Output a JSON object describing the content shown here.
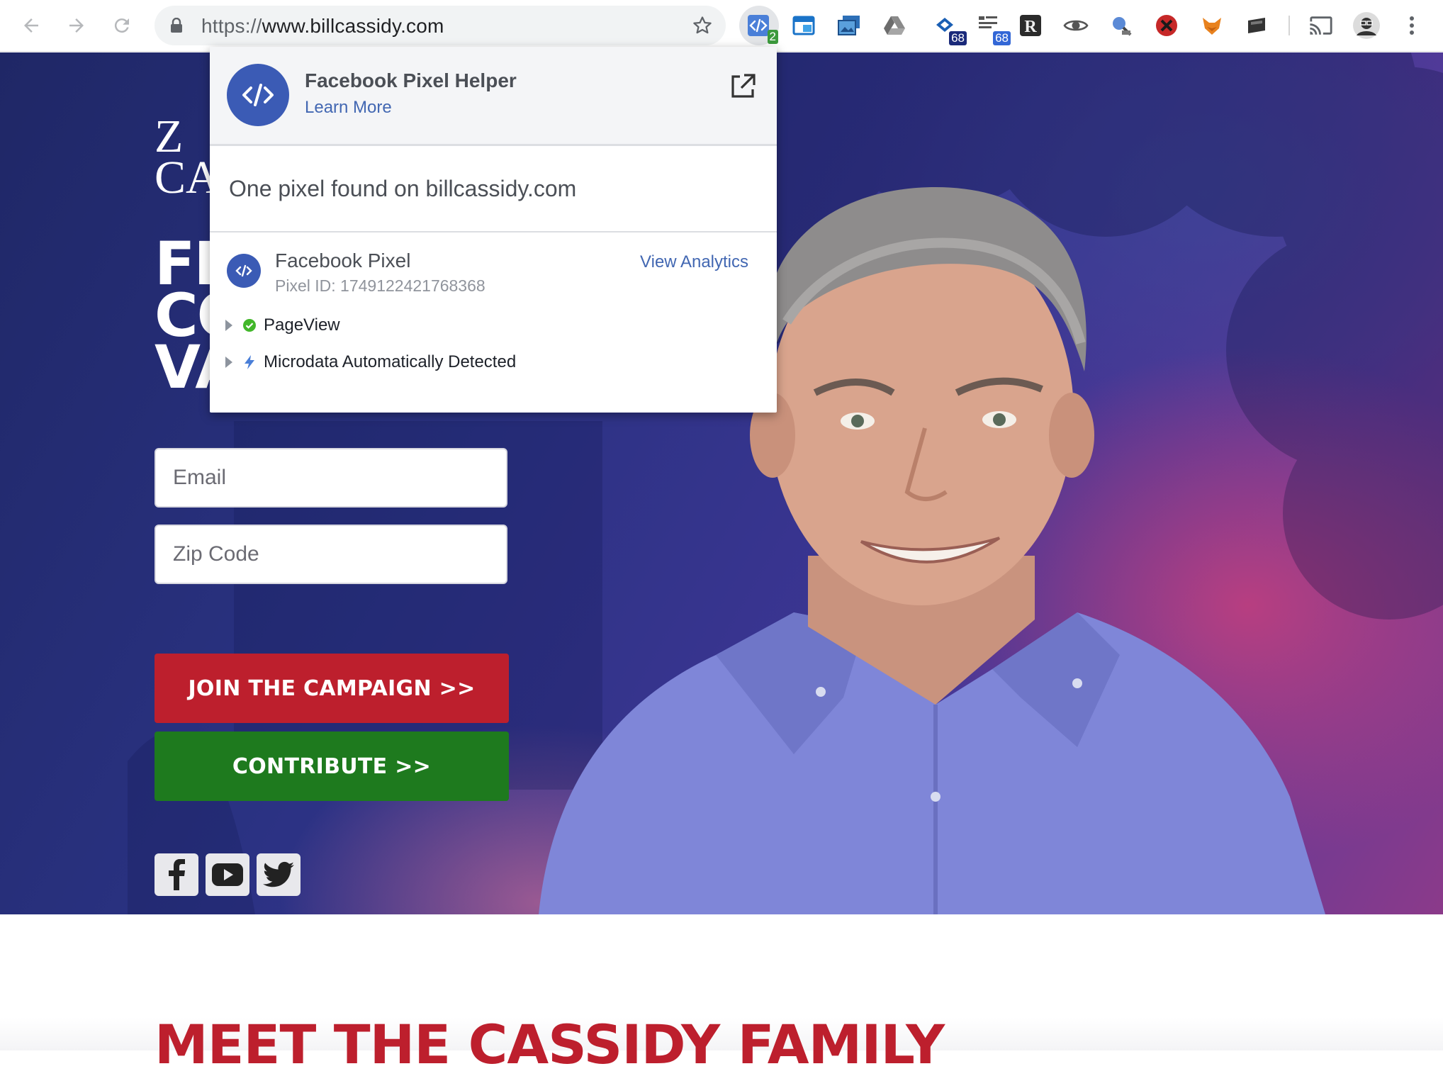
{
  "browser": {
    "url_scheme": "https://",
    "url_host": "www.billcassidy.com",
    "extension_badges": {
      "pixel_helper": "2",
      "ext_mail": "68",
      "ext_queue": "68"
    },
    "badge_colors": {
      "green": "#3c9a3c",
      "navy": "#1a2a7a",
      "blue": "#3367d6"
    }
  },
  "page": {
    "logo_line1": "Z",
    "logo_line2": "CA",
    "headline": [
      "FI",
      "CO",
      "VA"
    ],
    "email_placeholder": "Email",
    "zip_placeholder": "Zip Code",
    "join_label": "JOIN THE CAMPAIGN >>",
    "contribute_label": "CONTRIBUTE >>",
    "social": [
      "facebook-icon",
      "youtube-icon",
      "twitter-icon"
    ],
    "section_title": "MEET THE CASSIDY FAMILY",
    "colors": {
      "red": "#bd1f2d",
      "green": "#1e7a1e",
      "navy": "#1f2766"
    }
  },
  "popup": {
    "title": "Facebook Pixel Helper",
    "learn_more": "Learn More",
    "summary": "One pixel found on billcassidy.com",
    "pixel": {
      "name": "Facebook Pixel",
      "id_text": "Pixel ID: 1749122421768368",
      "view_analytics": "View Analytics",
      "events": [
        {
          "label": "PageView",
          "status": "success"
        },
        {
          "label": "Microdata Automatically Detected",
          "status": "info"
        }
      ]
    },
    "accent": "#4267b2"
  }
}
